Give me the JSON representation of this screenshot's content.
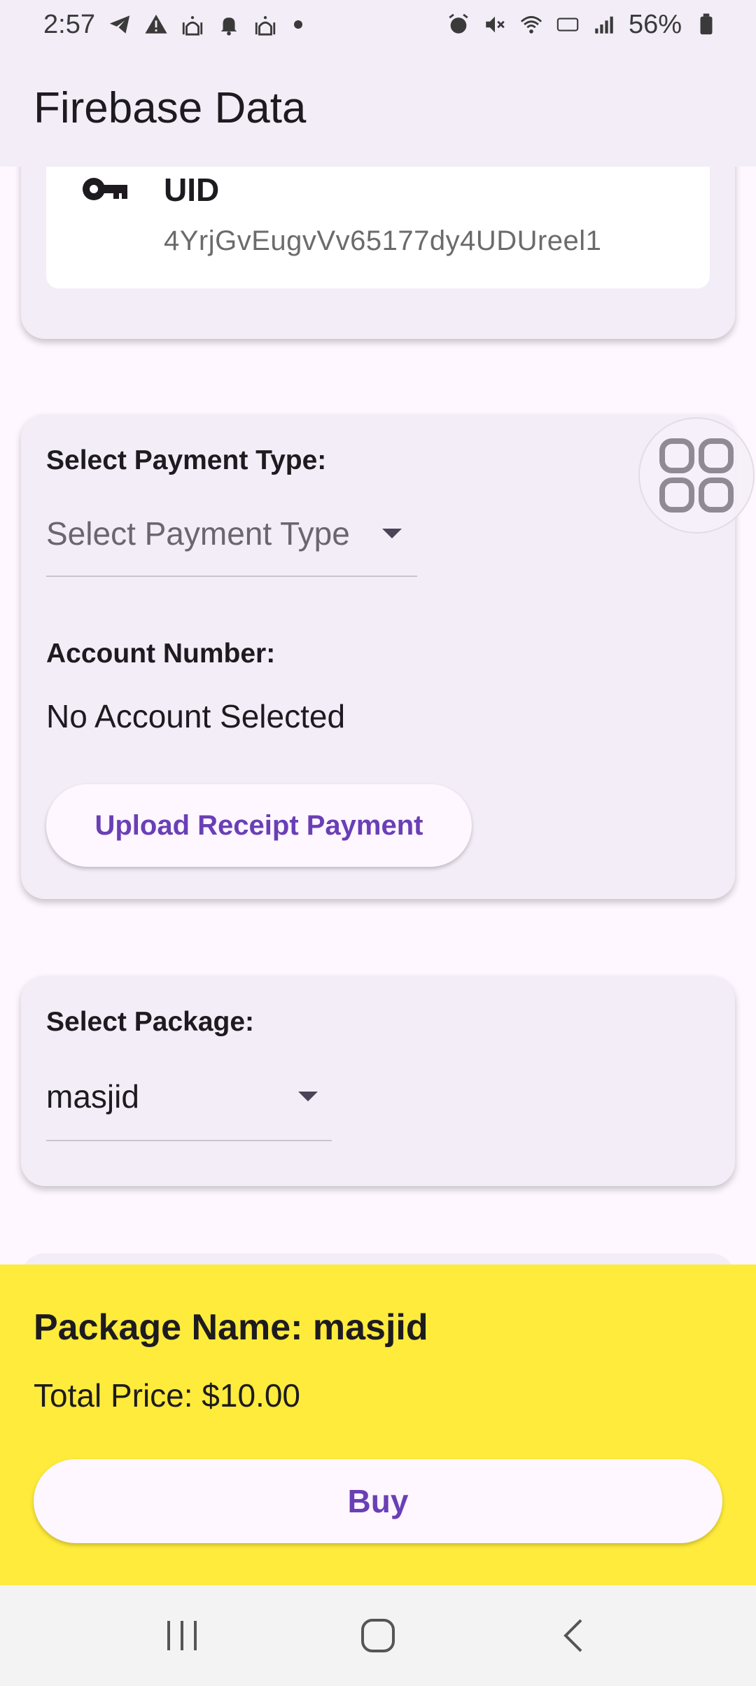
{
  "status_bar": {
    "time": "2:57",
    "battery": "56%",
    "left_icons": [
      "telegram-icon",
      "warning-icon",
      "mosque-icon",
      "bell-icon",
      "mosque-icon"
    ],
    "right_icons": [
      "alarm-icon",
      "mute-icon",
      "wifi-icon",
      "volte-icon",
      "signal-icon",
      "battery-icon"
    ]
  },
  "app_bar": {
    "title": "Firebase Data"
  },
  "uid_card": {
    "label": "UID",
    "value": "4YrjGvEugvVv65177dy4UDUreel1",
    "icon": "key-icon"
  },
  "payment_card": {
    "payment_type_label": "Select Payment Type:",
    "payment_type_placeholder": "Select Payment Type",
    "account_label": "Account Number:",
    "account_value": "No Account Selected",
    "upload_button": "Upload Receipt Payment"
  },
  "package_card": {
    "label": "Select Package:",
    "selected": "masjid"
  },
  "summary": {
    "package_name": "Package Name: masjid",
    "total_price": "Total Price: $10.00",
    "buy_button": "Buy"
  },
  "colors": {
    "background": "#fef7ff",
    "surface": "#f3edf7",
    "accent": "#6a3fb6",
    "summary_bg": "#ffeb3b"
  }
}
